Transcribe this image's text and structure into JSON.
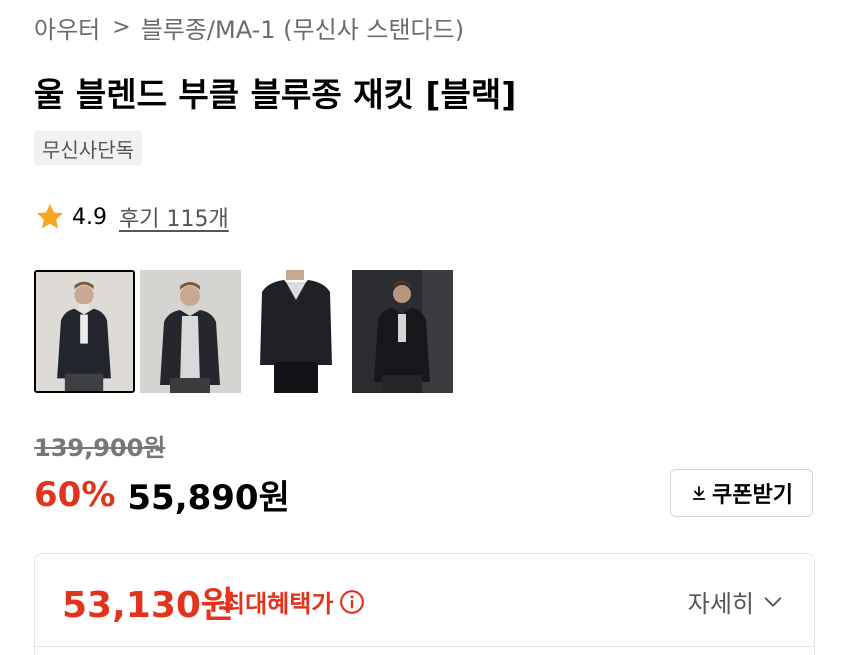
{
  "breadcrumb": {
    "category": "아우터",
    "separator": ">",
    "subcategory": "블루종/MA-1 (무신사 스탠다드)"
  },
  "product": {
    "title": "울 블렌드 부클 블루종 재킷 [블랙]",
    "badge": "무신사단독",
    "rating": "4.9",
    "reviews": "후기 115개",
    "thumbnails": [
      {
        "name": "front-pose"
      },
      {
        "name": "front-open"
      },
      {
        "name": "detail-closeup"
      },
      {
        "name": "dark-background"
      }
    ]
  },
  "pricing": {
    "original_price": "139,900원",
    "discount": "60%",
    "sale_price": "55,890원",
    "coupon_label": "쿠폰받기",
    "max_benefit_price": "53,130원",
    "max_benefit_label": "최대혜택가",
    "detail_label": "자세히"
  },
  "colors": {
    "accent_red": "#e2341d",
    "star": "#f5a623"
  },
  "icons": {
    "star": "star-icon",
    "download": "download-icon",
    "info": "info-icon",
    "chevron": "chevron-down-icon"
  }
}
